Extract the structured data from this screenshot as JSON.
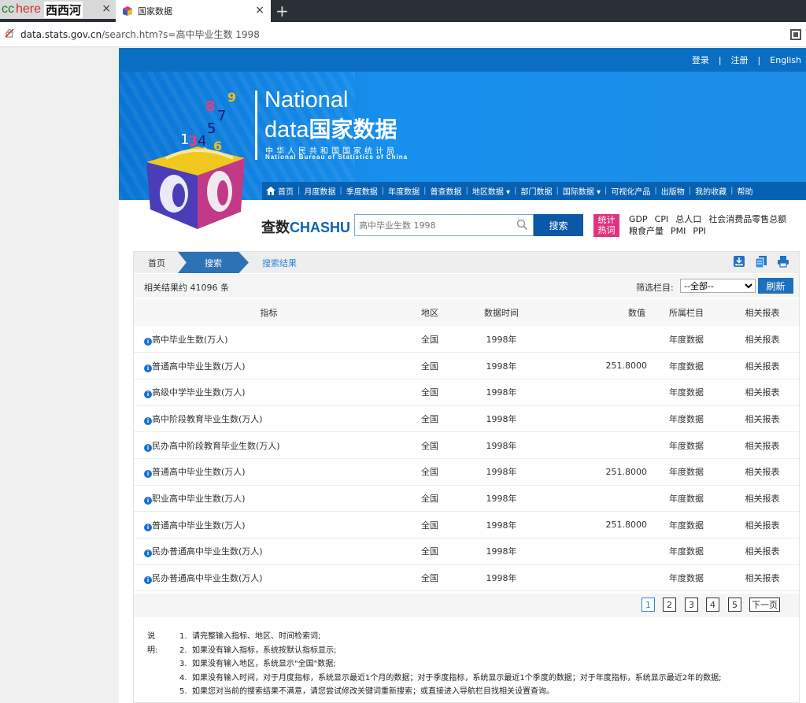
{
  "browser": {
    "tab1": {
      "cc": "cc",
      "here": "here",
      "name": "西西河"
    },
    "tab2_title": "国家数据",
    "close": "×",
    "new_tab": "+",
    "url_domain": "data.stats.gov.cn",
    "url_rest": "/search.htm?s=高中毕业生数 1998"
  },
  "site": {
    "top_links": [
      "登录",
      "|",
      "注册",
      "|",
      "English"
    ],
    "brand_en": "National",
    "brand_data_en": "data",
    "brand_data_cn": "国家数据",
    "brand_sub_cn": "中华人民共和国国家统计局",
    "brand_sub_en": "National Bureau of Statistics of China",
    "nav": [
      "首页",
      "月度数据",
      "季度数据",
      "年度数据",
      "普查数据",
      "地区数据 ▾",
      "部门数据",
      "国际数据 ▾",
      "可视化产品",
      "出版物",
      "我的收藏",
      "帮助"
    ],
    "chashu_cn": "查数",
    "chashu_en": "CHASHU",
    "search_value": "高中毕业生数 1998",
    "search_button": "搜索",
    "hot_badge_1": "统计",
    "hot_badge_2": "热词",
    "hot_terms": [
      "GDP",
      "CPI",
      "总人口",
      "社会消费品零售总额",
      "粮食产量",
      "PMI",
      "PPI"
    ]
  },
  "breadcrumb": {
    "home": "首页",
    "search": "搜索",
    "result": "搜索结果"
  },
  "results": {
    "count_text": "相关结果约 41096 条",
    "filter_label": "筛选栏目:",
    "filter_value": "--全部--",
    "refresh": "刷新",
    "headers": [
      "指标",
      "地区",
      "数据时间",
      "数值",
      "所属栏目",
      "相关报表"
    ],
    "rows": [
      {
        "name": "高中毕业生数(万人)",
        "region": "全国",
        "time": "1998年",
        "value": "",
        "column": "年度数据",
        "report": "相关报表"
      },
      {
        "name": "普通高中毕业生数(万人)",
        "region": "全国",
        "time": "1998年",
        "value": "251.8000",
        "column": "年度数据",
        "report": "相关报表"
      },
      {
        "name": "高级中学毕业生数(万人)",
        "region": "全国",
        "time": "1998年",
        "value": "",
        "column": "年度数据",
        "report": "相关报表"
      },
      {
        "name": "高中阶段教育毕业生数(万人)",
        "region": "全国",
        "time": "1998年",
        "value": "",
        "column": "年度数据",
        "report": "相关报表"
      },
      {
        "name": "民办高中阶段教育毕业生数(万人)",
        "region": "全国",
        "time": "1998年",
        "value": "",
        "column": "年度数据",
        "report": "相关报表"
      },
      {
        "name": "普通高中毕业生数(万人)",
        "region": "全国",
        "time": "1998年",
        "value": "251.8000",
        "column": "年度数据",
        "report": "相关报表"
      },
      {
        "name": "职业高中毕业生数(万人)",
        "region": "全国",
        "time": "1998年",
        "value": "",
        "column": "年度数据",
        "report": "相关报表"
      },
      {
        "name": "普通高中毕业生数(万人)",
        "region": "全国",
        "time": "1998年",
        "value": "251.8000",
        "column": "年度数据",
        "report": "相关报表"
      },
      {
        "name": "民办普通高中毕业生数(万人)",
        "region": "全国",
        "time": "1998年",
        "value": "",
        "column": "年度数据",
        "report": "相关报表"
      },
      {
        "name": "民办普通高中毕业生数(万人)",
        "region": "全国",
        "time": "1998年",
        "value": "",
        "column": "年度数据",
        "report": "相关报表"
      }
    ]
  },
  "pagination": {
    "pages": [
      "1",
      "2",
      "3",
      "4",
      "5"
    ],
    "current": "1",
    "next": "下一页"
  },
  "notes": {
    "label": "说明:",
    "items": [
      {
        "n": "1.",
        "text": "请完整输入指标、地区、时间检索词;"
      },
      {
        "n": "2.",
        "text": "如果没有输入指标，系统按默认指标显示;"
      },
      {
        "n": "3.",
        "text": "如果没有输入地区，系统显示\"全国\"数据;"
      },
      {
        "n": "4.",
        "text": "如果没有输入时间，对于月度指标，系统显示最近1个月的数据；对于季度指标，系统显示最近1个季度的数据；对于年度指标，系统显示最近2年的数据;"
      },
      {
        "n": "5.",
        "text": "如果您对当前的搜索结果不满意，请您尝试修改关键词重新搜索；或直接进入导航栏目找相关设置查询。"
      }
    ]
  },
  "colors": {
    "brand_blue": "#1890ee",
    "nav_blue": "#0661b3",
    "hot_pink": "#e0327f",
    "search_blue": "#0b58a6",
    "link_blue": "#2f86d8"
  }
}
